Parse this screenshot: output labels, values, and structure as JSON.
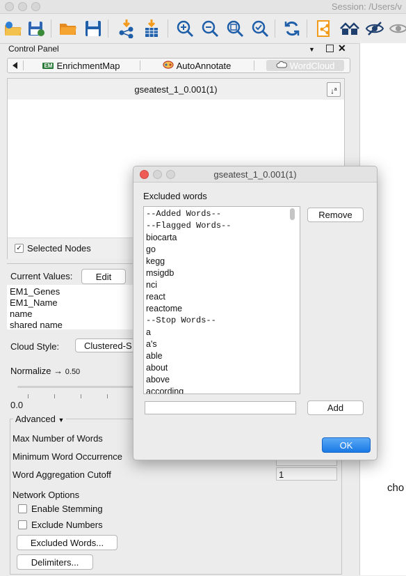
{
  "window": {
    "session_text": "Session: /Users/v"
  },
  "toolbar": {
    "icons": [
      "open-session-icon",
      "save-session-icon",
      "open-file-icon",
      "save-file-icon",
      "import-network-icon",
      "import-table-icon",
      "zoom-in-icon",
      "zoom-out-icon",
      "zoom-fit-icon",
      "zoom-selected-icon",
      "refresh-icon",
      "share-icon",
      "home-icon",
      "hide-icon",
      "show-icon"
    ]
  },
  "control_panel": {
    "title": "Control Panel",
    "tabs": [
      {
        "label": "EnrichmentMap",
        "badge": "EM"
      },
      {
        "label": "AutoAnnotate"
      },
      {
        "label": "WordCloud"
      }
    ],
    "cloud_name": "gseatest_1_0.001(1)",
    "selected_nodes_label": "Selected Nodes",
    "current_values_label": "Current Values:",
    "edit_label": "Edit",
    "attributes": [
      "EM1_Genes",
      "EM1_Name",
      "name",
      "shared name"
    ],
    "cloud_style_label": "Cloud Style:",
    "cloud_style_value": "Clustered-S",
    "normalize_label": "Normalize",
    "normalize_value": "0.50",
    "slider_min": "0.0",
    "advanced_label": "Advanced",
    "max_words_label": "Max Number of Words",
    "min_occurrence_label": "Minimum Word Occurrence",
    "aggregation_label": "Word Aggregation Cutoff",
    "aggregation_value": "1",
    "network_options_label": "Network Options",
    "enable_stemming_label": "Enable Stemming",
    "exclude_numbers_label": "Exclude Numbers",
    "excluded_words_button": "Excluded Words...",
    "delimiters_button": "Delimiters..."
  },
  "right_panel": {
    "partial_text": "cho"
  },
  "dialog": {
    "title": "gseatest_1_0.001(1)",
    "excluded_words_label": "Excluded words",
    "words": [
      "--Added Words--",
      "--Flagged Words--",
      "biocarta",
      "go",
      "kegg",
      "msigdb",
      "nci",
      "react",
      "reactome",
      "--Stop Words--",
      "a",
      "a's",
      "able",
      "about",
      "above",
      "according"
    ],
    "remove_label": "Remove",
    "add_label": "Add",
    "add_input_value": "",
    "ok_label": "OK"
  }
}
